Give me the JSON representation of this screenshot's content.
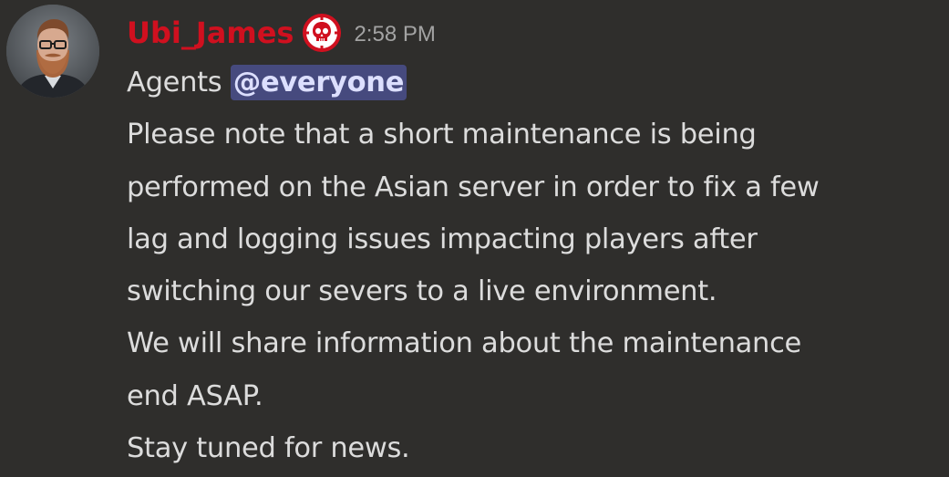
{
  "message": {
    "author": {
      "username": "Ubi_James",
      "avatar_icon": "profile-photo-bearded-man-with-glasses",
      "role_icon": "division-skull-crosshair-icon",
      "name_color": "#d0101f"
    },
    "timestamp": "2:58 PM",
    "intro_text": "Agents ",
    "mention": "@everyone",
    "lines": [
      "Please note that a short maintenance is being",
      "performed on the Asian server in order to fix a few",
      "lag and logging issues impacting players after",
      "switching our severs to a live environment.",
      "We will share information about the maintenance",
      "end ASAP.",
      "Stay tuned for news."
    ]
  },
  "colors": {
    "background": "#2f2e2c",
    "text": "#dcdcdc",
    "mention_background": "#464a7e",
    "mention_text": "#dcdffe",
    "timestamp": "#a3a3a3"
  }
}
